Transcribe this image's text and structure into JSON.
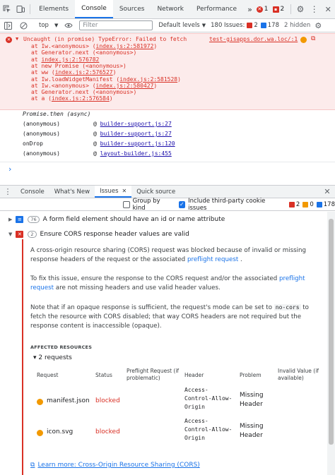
{
  "tabbar": {
    "tabs": [
      "Elements",
      "Console",
      "Sources",
      "Network",
      "Performance"
    ],
    "more": "»",
    "error_count": "1",
    "warning_count": "2"
  },
  "toolbar": {
    "context": "top",
    "filter_placeholder": "Filter",
    "levels": "Default levels",
    "issues_label": "180 Issues:",
    "issues_err": "2",
    "issues_info": "178",
    "hidden": "2 hidden"
  },
  "error": {
    "message": "Uncaught (in promise) TypeError: Failed to fetch",
    "source": "test-gisapps.dor.wa.loc/:1",
    "stack": [
      {
        "pre": "at Iw.<anonymous> (",
        "link": "index.js:2:581972",
        "post": ")"
      },
      {
        "pre": "at Generator.next (<anonymous>)",
        "link": "",
        "post": ""
      },
      {
        "pre": "at ",
        "link": "index.js:2:576782",
        "post": ""
      },
      {
        "pre": "at new Promise (<anonymous>)",
        "link": "",
        "post": ""
      },
      {
        "pre": "at ww (",
        "link": "index.js:2:576527",
        "post": ")"
      },
      {
        "pre": "at Iw.loadWidgetManifest (",
        "link": "index.js:2:581528",
        "post": ")"
      },
      {
        "pre": "at Iw.<anonymous> (",
        "link": "index.js:2:580427",
        "post": ")"
      },
      {
        "pre": "at Generator.next (<anonymous>)",
        "link": "",
        "post": ""
      },
      {
        "pre": "at a (",
        "link": "index.js:2:576584",
        "post": ")"
      }
    ]
  },
  "async": {
    "label": "Promise.then (async)",
    "frames": [
      {
        "name": "(anonymous)",
        "at": "@",
        "link": "builder-support.js:27"
      },
      {
        "name": "(anonymous)",
        "at": "@",
        "link": "builder-support.js:27"
      },
      {
        "name": "onDrop",
        "at": "@",
        "link": "builder-support.js:120"
      },
      {
        "name": "(anonymous)",
        "at": "@",
        "link": "layout-builder.js:455"
      }
    ]
  },
  "prompt": "›",
  "drawer": {
    "tabs": [
      "Console",
      "What's New",
      "Issues",
      "Quick source"
    ],
    "group_by_kind": "Group by kind",
    "third_party": "Include third-party cookie issues",
    "count_err": "2",
    "count_warn": "0",
    "count_info": "178"
  },
  "issue1": {
    "count": "76",
    "title": "A form field element should have an id or name attribute"
  },
  "issue2": {
    "count": "2",
    "title": "Ensure CORS response header values are valid",
    "p1_a": "A cross-origin resource sharing (CORS) request was blocked because of invalid or missing response headers of the request or the associated ",
    "p1_link": "preflight request",
    "p1_b": " .",
    "p2_a": "To fix this issue, ensure the response to the CORS request and/or the associated ",
    "p2_link": "preflight request",
    "p2_b": " are not missing headers and use valid header values.",
    "p3_a": "Note that if an opaque response is sufficient, the request's mode can be set to ",
    "p3_code": "no-cors",
    "p3_b": " to fetch the resource with CORS disabled; that way CORS headers are not required but the response content is inaccessible (opaque).",
    "affected": "AFFECTED RESOURCES",
    "requests_count": "▾ 2 requests",
    "headers": {
      "request": "Request",
      "status": "Status",
      "preflight": "Preflight Request (if problematic)",
      "header": "Header",
      "problem": "Problem",
      "invalid": "Invalid Value (if available)"
    },
    "rows": [
      {
        "request": "manifest.json",
        "status": "blocked",
        "header": "Access-Control-Allow-Origin",
        "problem": "Missing Header"
      },
      {
        "request": "icon.svg",
        "status": "blocked",
        "header": "Access-Control-Allow-Origin",
        "problem": "Missing Header"
      }
    ],
    "learn_more": "Learn more: Cross-Origin Resource Sharing (CORS)"
  }
}
